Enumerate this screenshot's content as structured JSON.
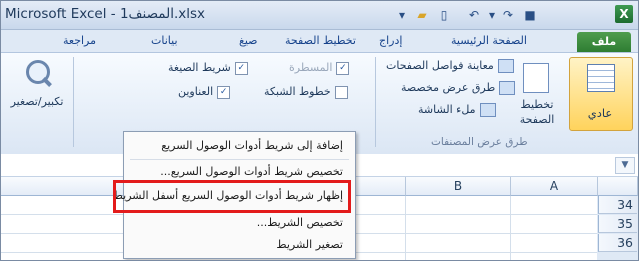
{
  "window": {
    "title": "Microsoft Excel - المصنف1.xlsx",
    "app_icon": "excel-icon"
  },
  "quick_access": {
    "icons": [
      "customize-dropdown-icon",
      "folder-open-icon",
      "new-document-icon",
      "undo-icon",
      "redo-icon",
      "dropdown-icon",
      "save-icon"
    ]
  },
  "tabs": {
    "file": "ملف",
    "home": "الصفحة الرئيسية",
    "insert": "إدراج",
    "page_layout": "تخطيط الصفحة",
    "formulas": "صيغ",
    "data": "بيانات",
    "review": "مراجعة"
  },
  "ribbon": {
    "workbook_views": {
      "normal": "عادي",
      "page_layout": "تخطيط الصفحة",
      "page_break_preview": "معاينة فواصل الصفحات",
      "custom_views": "طرق عرض مخصصة",
      "full_screen": "ملء الشاشة",
      "group_label": "طرق عرض المصنفات"
    },
    "show": {
      "ruler": "المسطرة",
      "formula_bar": "شريط الصيغة",
      "gridlines": "خطوط الشبكة",
      "headings": "العناوين"
    },
    "zoom": {
      "label": "تكبير/تصغير"
    }
  },
  "sheet": {
    "columns": [
      "A",
      "B"
    ],
    "rows": [
      "34",
      "35",
      "36"
    ]
  },
  "context_menu": {
    "items": [
      {
        "label": "إضافة إلى شريط أدوات الوصول السريع"
      },
      {
        "label": "تخصيص شريط أدوات الوصول السريع..."
      },
      {
        "label": "إظهار شريط أدوات الوصول السريع أسفل الشريط"
      },
      {
        "label": "تخصيص الشريط..."
      },
      {
        "label": "تصغير الشريط"
      }
    ]
  },
  "colors": {
    "highlight": "#e31b1b",
    "file_tab": "#2e7d32",
    "selected_view": "#ffd35c"
  }
}
